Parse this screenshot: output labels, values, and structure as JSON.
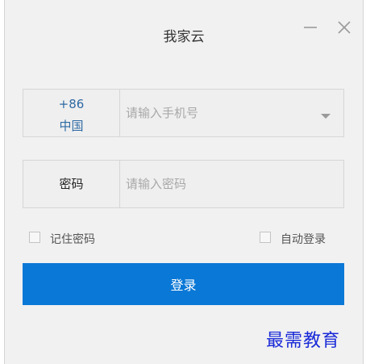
{
  "window": {
    "title": "我家云"
  },
  "phone_field": {
    "country_code": "+86",
    "country_name": "中国",
    "placeholder": "请输入手机号",
    "value": ""
  },
  "password_field": {
    "label": "密码",
    "placeholder": "请输入密码",
    "value": ""
  },
  "options": {
    "remember_password": "记住密码",
    "auto_login": "自动登录"
  },
  "login_button": {
    "label": "登录"
  },
  "watermark": {
    "text": "最需教育"
  },
  "icons": {
    "minimize": "minimize-icon",
    "close": "close-icon",
    "dropdown": "chevron-down-icon"
  },
  "colors": {
    "accent": "#0a78d6",
    "region_text": "#2e6aa3",
    "window_bg": "#f1f1f1",
    "watermark": "#1a2ad8"
  }
}
